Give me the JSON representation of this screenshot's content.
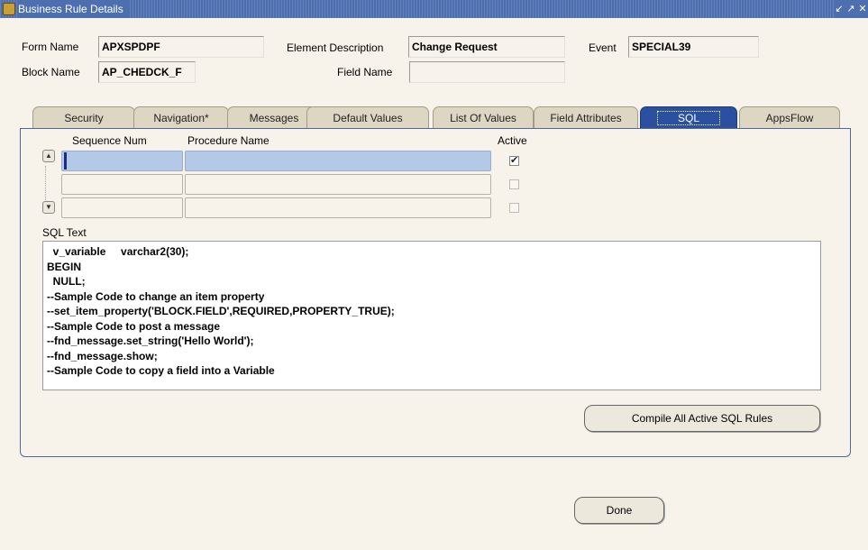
{
  "window": {
    "title": "Business Rule Details",
    "controls": [
      "↙",
      "↗",
      "✕"
    ]
  },
  "header": {
    "form_name_label": "Form Name",
    "form_name_value": "APXSPDPF",
    "element_description_label": "Element Description",
    "element_description_value": "Change Request",
    "event_label": "Event",
    "event_value": "SPECIAL39",
    "block_name_label": "Block Name",
    "block_name_value": "AP_CHEDCK_F",
    "field_name_label": "Field Name",
    "field_name_value": ""
  },
  "tabs": [
    {
      "label": "Security",
      "active": false
    },
    {
      "label": "Navigation*",
      "active": false
    },
    {
      "label": "Messages",
      "active": false
    },
    {
      "label": "Default Values",
      "active": false
    },
    {
      "label": "List Of Values",
      "active": false
    },
    {
      "label": "Field Attributes",
      "active": false
    },
    {
      "label": "SQL",
      "active": true
    },
    {
      "label": "AppsFlow",
      "active": false
    }
  ],
  "sql_tab": {
    "columns": {
      "sequence": "Sequence Num",
      "procedure": "Procedure Name",
      "active": "Active"
    },
    "rows": [
      {
        "sequence": "",
        "procedure": "",
        "active": true,
        "selected": true
      },
      {
        "sequence": "",
        "procedure": "",
        "active": false,
        "selected": false
      },
      {
        "sequence": "",
        "procedure": "",
        "active": false,
        "selected": false
      }
    ],
    "sql_text_label": "SQL Text",
    "sql_text": "  v_variable     varchar2(30);\nBEGIN\n  NULL;\n--Sample Code to change an item property\n--set_item_property('BLOCK.FIELD',REQUIRED,PROPERTY_TRUE);\n--Sample Code to post a message\n--fnd_message.set_string('Hello World');\n--fnd_message.show;\n--Sample Code to copy a field into a Variable",
    "compile_button": "Compile All Active SQL Rules"
  },
  "done_button": "Done"
}
